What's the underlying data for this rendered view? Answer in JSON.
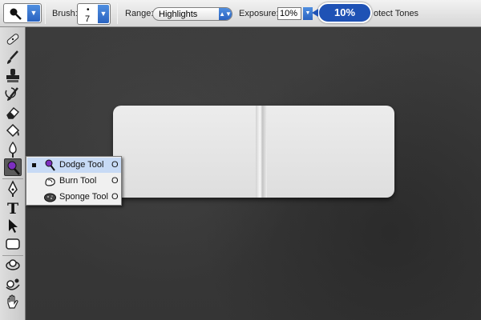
{
  "options_bar": {
    "brush_label": "Brush:",
    "brush_size": "7",
    "range_label": "Range:",
    "range_value": "Highlights",
    "exposure_label": "Exposure:",
    "exposure_value": "10%",
    "exposure_callout": "10%",
    "protect_tones_label": "otect Tones"
  },
  "toolbox": {
    "tools": [
      {
        "name": "healing-brush-icon"
      },
      {
        "name": "brush-icon"
      },
      {
        "name": "clone-stamp-icon"
      },
      {
        "name": "history-brush-icon"
      },
      {
        "name": "eraser-icon"
      },
      {
        "name": "paint-bucket-icon"
      },
      {
        "name": "blur-icon"
      },
      {
        "name": "dodge-icon",
        "active": true
      },
      {
        "name": "pen-icon"
      },
      {
        "name": "type-icon"
      },
      {
        "name": "path-selection-icon"
      },
      {
        "name": "shape-icon"
      },
      {
        "name": "3d-rotate-icon"
      },
      {
        "name": "3d-orbit-icon"
      },
      {
        "name": "hand-icon"
      }
    ],
    "type_glyph": "T"
  },
  "flyout": {
    "items": [
      {
        "label": "Dodge Tool",
        "shortcut": "O",
        "selected": true,
        "icon": "dodge-icon"
      },
      {
        "label": "Burn Tool",
        "shortcut": "O",
        "selected": false,
        "icon": "burn-icon"
      },
      {
        "label": "Sponge Tool",
        "shortcut": "O",
        "selected": false,
        "icon": "sponge-icon"
      }
    ]
  },
  "colors": {
    "accent": "#2a63c0",
    "callout": "#1f52b5",
    "canvas": "#3a3a3a",
    "sticker": "#e6e6e6",
    "flyout_selected": "#c7daf5"
  }
}
